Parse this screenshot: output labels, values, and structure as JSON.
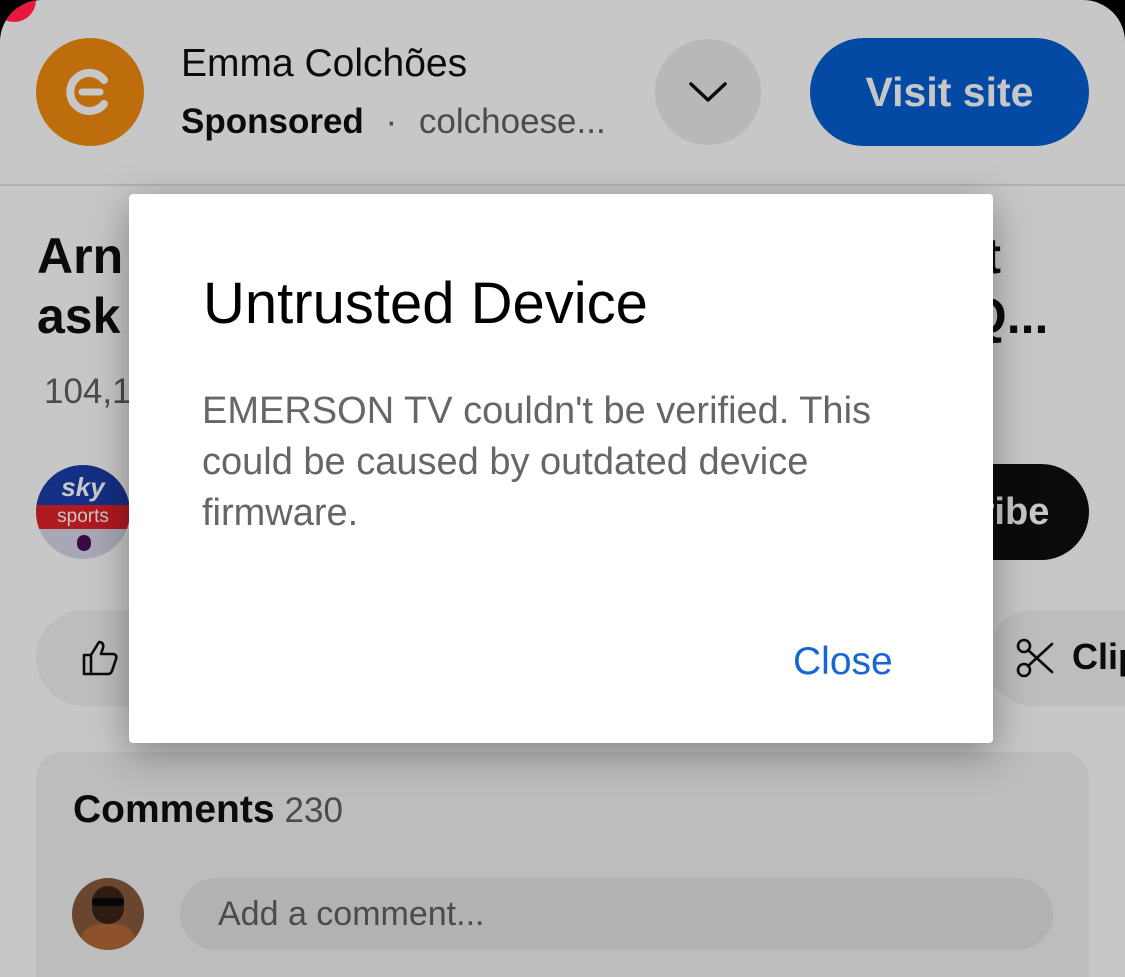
{
  "ad": {
    "advertiser": "Emma Colchões",
    "sponsored_label": "Sponsored",
    "separator": "·",
    "domain": "colchoese...",
    "visit_label": "Visit site",
    "logo_icon": "emma-logo-icon",
    "logo_color": "#f28c0f",
    "visit_color": "#065fd4"
  },
  "video": {
    "title_visible": "Arn                                                              t\nask                                                             Q...",
    "views_visible": "104,1",
    "channel_avatar_text": "sky",
    "channel_avatar_subtext": "sports",
    "subscribe_visible": "ribe"
  },
  "actions": {
    "like_icon": "thumbs-up-icon",
    "clip_icon": "scissors-icon",
    "clip_label_visible": "Clip"
  },
  "comments": {
    "title": "Comments",
    "count": "230",
    "placeholder": "Add a comment..."
  },
  "dialog": {
    "title": "Untrusted Device",
    "message": "EMERSON TV couldn't be verified. This could be caused by outdated device firmware.",
    "close_label": "Close",
    "link_color": "#1766d6"
  }
}
